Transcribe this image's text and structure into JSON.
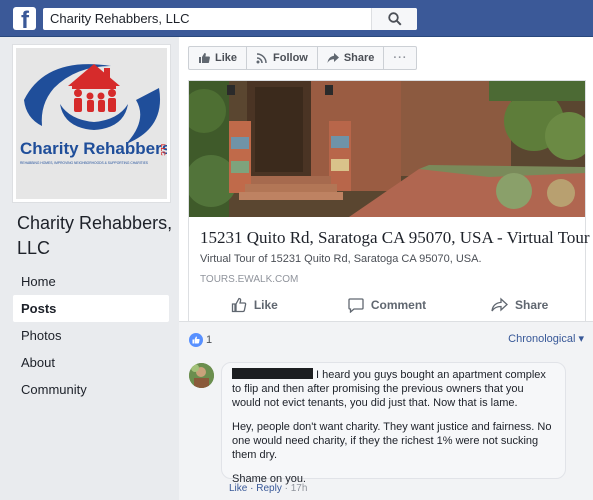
{
  "topbar": {
    "search_value": "Charity Rehabbers, LLC",
    "brand_color": "#3b5998"
  },
  "page": {
    "name": "Charity Rehabbers, LLC",
    "logo_text": "Charity Rehabbers",
    "logo_llc": "LLC",
    "logo_tagline": "REHABBING HOMES, IMPROVING NEIGHBORHOODS & SUPPORTING CHARITIES"
  },
  "nav": {
    "items": [
      {
        "label": "Home"
      },
      {
        "label": "Posts"
      },
      {
        "label": "Photos"
      },
      {
        "label": "About"
      },
      {
        "label": "Community"
      }
    ],
    "active": "Posts"
  },
  "post_actions": {
    "like": "Like",
    "follow": "Follow",
    "share": "Share",
    "more": "···"
  },
  "link_preview": {
    "title": "15231 Quito Rd, Saratoga CA 95070, USA - Virtual Tour",
    "description": "Virtual Tour of 15231 Quito Rd, Saratoga CA 95070, USA.",
    "domain": "TOURS.EWALK.COM"
  },
  "reactions": {
    "like": "Like",
    "comment": "Comment",
    "share": "Share"
  },
  "comments_header": {
    "like_count": "1",
    "sort_label": "Chronological ▾"
  },
  "comment": {
    "para1": "I heard you guys bought an apartment complex to flip and then after promising the previous owners that you would not evict tenants, you did just that. Now that is lame.",
    "para2": "Hey, people don't want charity. They want justice and fairness. No one would need charity, if they the richest 1% were not sucking them dry.",
    "para3": "Shame on you.",
    "like": "Like",
    "reply": "Reply",
    "time": "17h"
  }
}
